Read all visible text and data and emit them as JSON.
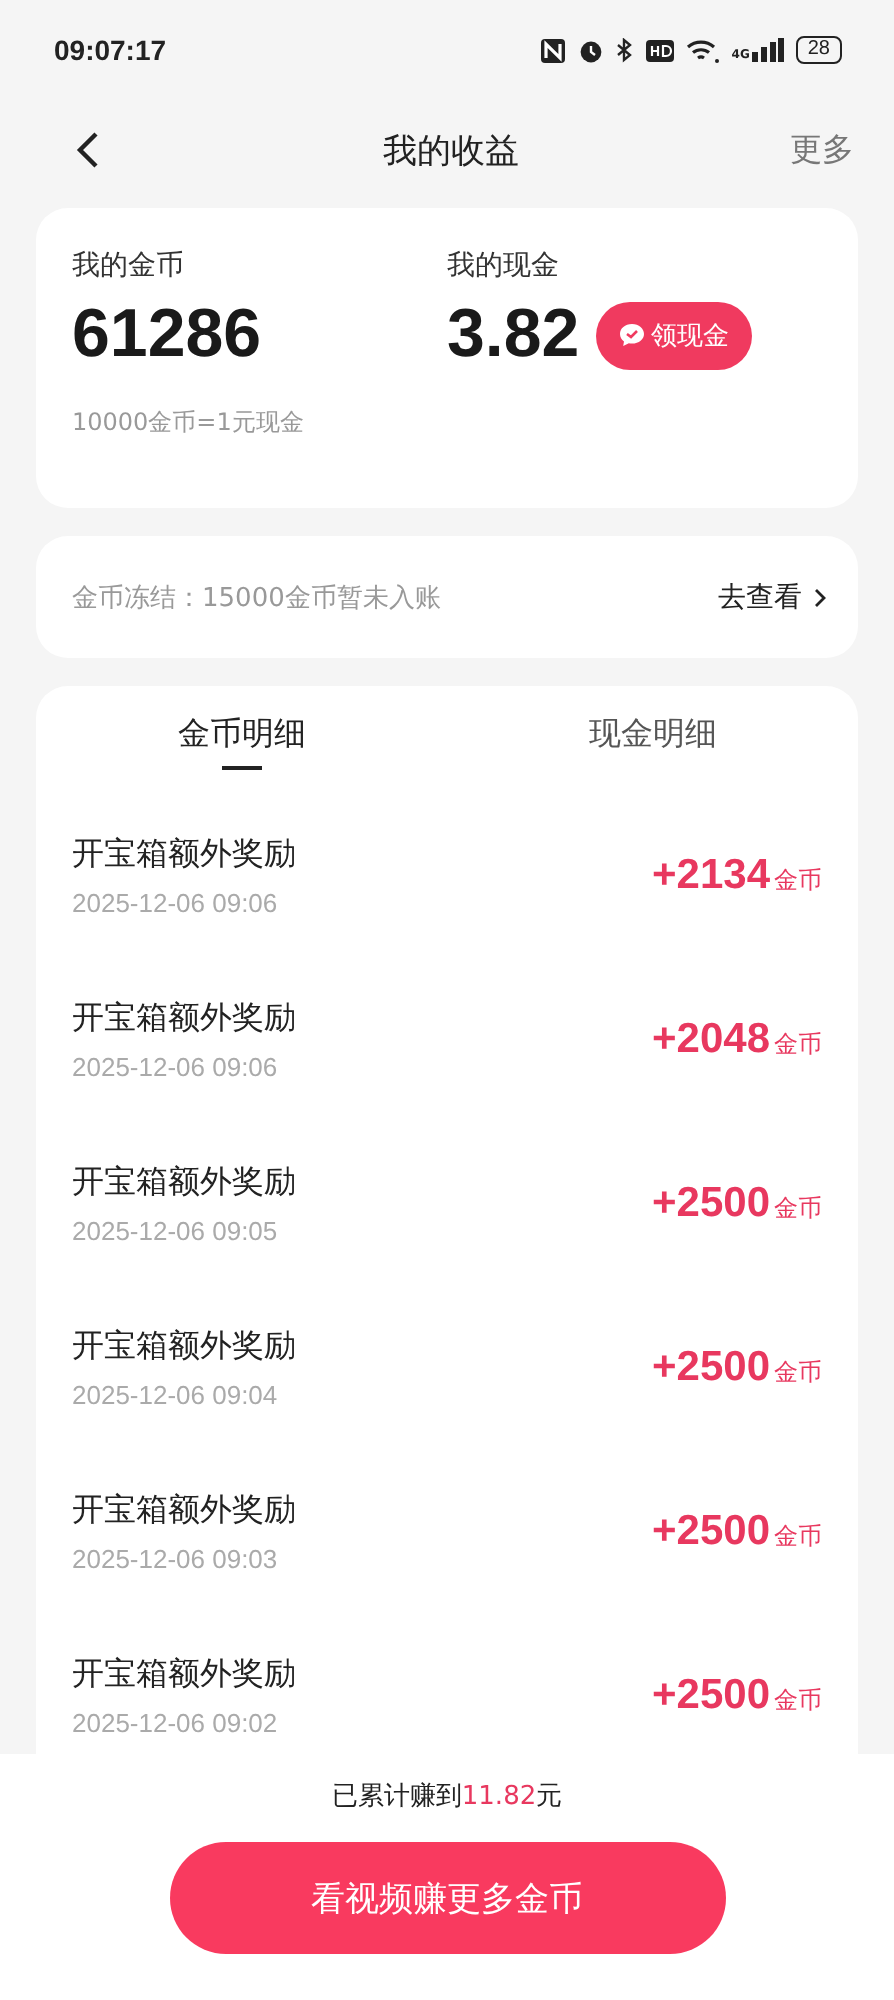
{
  "status_bar": {
    "time": "09:07:17",
    "network": "4G",
    "battery": "28"
  },
  "header": {
    "title": "我的收益",
    "more": "更多"
  },
  "balance": {
    "coins_label": "我的金币",
    "coins": "61286",
    "cash_label": "我的现金",
    "cash": "3.82",
    "withdraw_button": "领现金",
    "rate": "10000金币=1元现金"
  },
  "frozen": {
    "text": "金币冻结：15000金币暂未入账",
    "link": "去查看"
  },
  "tabs": [
    {
      "label": "金币明细",
      "selected": true
    },
    {
      "label": "现金明细",
      "selected": false
    }
  ],
  "records": [
    {
      "title": "开宝箱额外奖励",
      "time": "2025-12-06 09:06",
      "amount": "+2134",
      "unit": "金币"
    },
    {
      "title": "开宝箱额外奖励",
      "time": "2025-12-06 09:06",
      "amount": "+2048",
      "unit": "金币"
    },
    {
      "title": "开宝箱额外奖励",
      "time": "2025-12-06 09:05",
      "amount": "+2500",
      "unit": "金币"
    },
    {
      "title": "开宝箱额外奖励",
      "time": "2025-12-06 09:04",
      "amount": "+2500",
      "unit": "金币"
    },
    {
      "title": "开宝箱额外奖励",
      "time": "2025-12-06 09:03",
      "amount": "+2500",
      "unit": "金币"
    },
    {
      "title": "开宝箱额外奖励",
      "time": "2025-12-06 09:02",
      "amount": "+2500",
      "unit": "金币"
    }
  ],
  "footer": {
    "total_prefix": "已累计赚到",
    "total_amount": "11.82",
    "total_suffix": "元",
    "button": "看视频赚更多金币"
  }
}
